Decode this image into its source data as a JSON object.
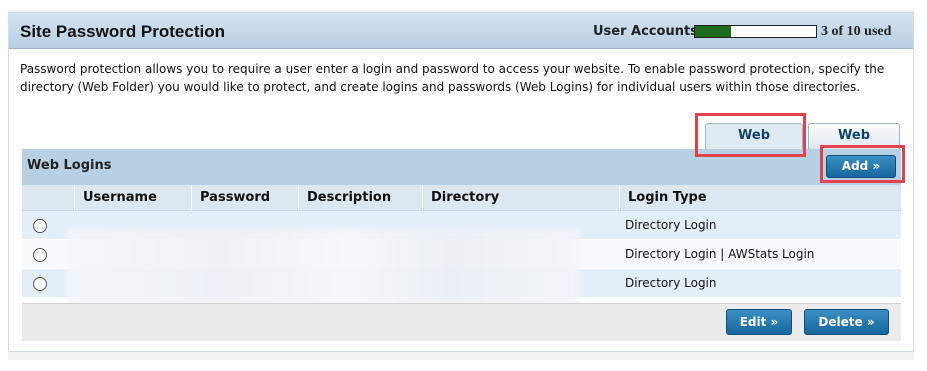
{
  "header": {
    "title": "Site Password Protection",
    "user_accounts_label": "User Accounts:",
    "user_accounts_count": "3 of 10 used",
    "user_accounts_used_fraction": 0.3
  },
  "description": "Password protection allows you to require a user enter a login and password to access your website. To enable password protection, specify the directory (Web Folder) you would like to protect, and create logins and passwords (Web Logins) for individual users within those directories.",
  "tabs": [
    {
      "label": "Web Logins",
      "active": true
    },
    {
      "label": "Web Folders",
      "active": false
    }
  ],
  "section": {
    "title": "Web Logins",
    "add_label": "Add »"
  },
  "table": {
    "columns": [
      "Username",
      "Password",
      "Description",
      "Directory",
      "Login Type"
    ],
    "rows": [
      {
        "login_type": "Directory Login"
      },
      {
        "login_type": "Directory Login | AWStats Login"
      },
      {
        "login_type": "Directory Login"
      }
    ]
  },
  "footer": {
    "edit_label": "Edit »",
    "delete_label": "Delete »"
  },
  "colors": {
    "accent": "#17679d",
    "meter_fill": "#1c6b1c",
    "highlight": "#e2434b"
  }
}
